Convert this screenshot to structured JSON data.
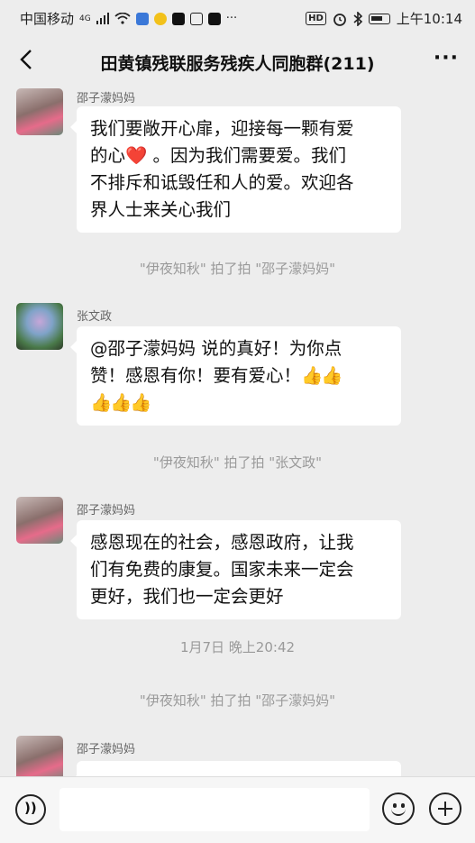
{
  "status_bar": {
    "carrier": "中国移动",
    "network": "4G",
    "time": "上午10:14",
    "hd_badge": "HD"
  },
  "header": {
    "back_icon": "chevron-left-icon",
    "title": "田黄镇残联服务残疾人同胞群(211)",
    "more_icon": "more-dots-icon"
  },
  "messages": [
    {
      "sender": "邵子濛妈妈",
      "line1": "我们要敞开心扉，迎接每一颗有爱",
      "line2_a": "的心",
      "line2_emoji": "❤️",
      "line2_b": " 。因为我们需要爱。我们",
      "line3": "不排斥和诋毁任和人的爱。欢迎各",
      "line4": "界人士来关心我们"
    },
    {
      "system": "\"伊夜知秋\" 拍了拍 \"邵子濛妈妈\""
    },
    {
      "sender": "张文政",
      "line1": "@邵子濛妈妈  说的真好！为你点",
      "line2": "赞！感恩有你！要有爱心！",
      "emoji": "👍"
    },
    {
      "system": "\"伊夜知秋\" 拍了拍 \"张文政\""
    },
    {
      "sender": "邵子濛妈妈",
      "line1": "感恩现在的社会，感恩政府，让我",
      "line2": "们有免费的康复。国家未来一定会",
      "line3": "更好，我们也一定会更好"
    },
    {
      "timestamp": "1月7日 晚上20:42"
    },
    {
      "system": "\"伊夜知秋\" 拍了拍 \"邵子濛妈妈\""
    },
    {
      "sender": "邵子濛妈妈"
    }
  ],
  "input_bar": {
    "voice_icon": "voice-icon",
    "emoji_icon": "emoji-icon",
    "plus_icon": "plus-icon"
  }
}
